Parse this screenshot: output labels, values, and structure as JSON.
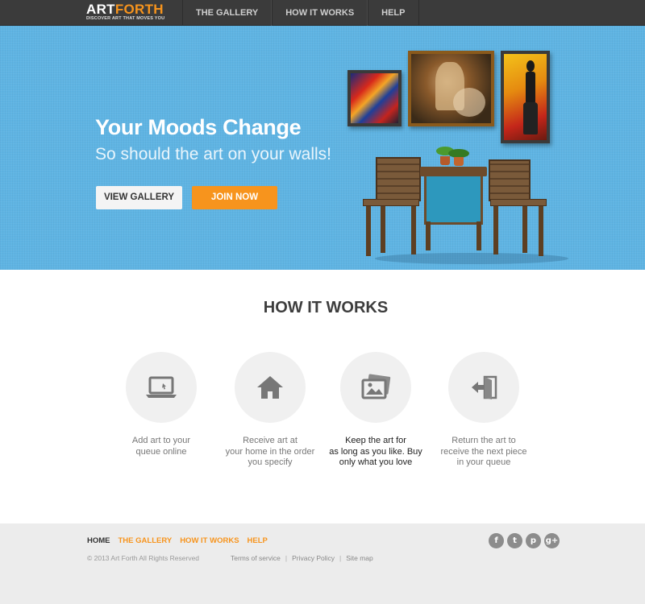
{
  "brand": {
    "name_part1": "ART",
    "name_part2": "FORTH",
    "tagline": "DISCOVER ART THAT MOVES YOU"
  },
  "nav": {
    "items": [
      {
        "label": "THE GALLERY"
      },
      {
        "label": "HOW IT WORKS"
      },
      {
        "label": "HELP"
      }
    ]
  },
  "hero": {
    "title": "Your Moods Change",
    "subtitle": "So should the art on your walls!",
    "view_gallery_label": "VIEW GALLERY",
    "join_now_label": "JOIN NOW"
  },
  "how_it_works": {
    "title": "HOW IT WORKS",
    "steps": [
      {
        "icon": "laptop-icon",
        "line1": "Add art to your",
        "line2": "queue online",
        "line3": ""
      },
      {
        "icon": "home-icon",
        "line1": "Receive art at",
        "line2": "your home in the order",
        "line3": "you specify"
      },
      {
        "icon": "pictures-icon",
        "line1": "Keep the art for",
        "line2": "as long as you like. Buy",
        "line3": "only what you love"
      },
      {
        "icon": "return-door-icon",
        "line1": "Return the art to",
        "line2": "receive the next piece",
        "line3": "in your queue"
      }
    ]
  },
  "footer": {
    "nav": {
      "home": "HOME",
      "gallery": "THE GALLERY",
      "how_it_works": "HOW IT WORKS",
      "help": "HELP"
    },
    "copyright": "© 2013 Art Forth All Rights Reserved",
    "terms": "Terms of service",
    "privacy": "Privacy Policy",
    "sitemap": "Site map",
    "separator": "|",
    "socials": [
      {
        "icon": "facebook-icon",
        "glyph": "f"
      },
      {
        "icon": "twitter-icon",
        "glyph": "t"
      },
      {
        "icon": "pinterest-icon",
        "glyph": "p"
      },
      {
        "icon": "google-plus-icon",
        "glyph": "g+"
      }
    ]
  },
  "colors": {
    "accent": "#f7941d",
    "hero_bg": "#5fb4e3",
    "topbar": "#3b3b3b",
    "footer_bg": "#ececec"
  }
}
